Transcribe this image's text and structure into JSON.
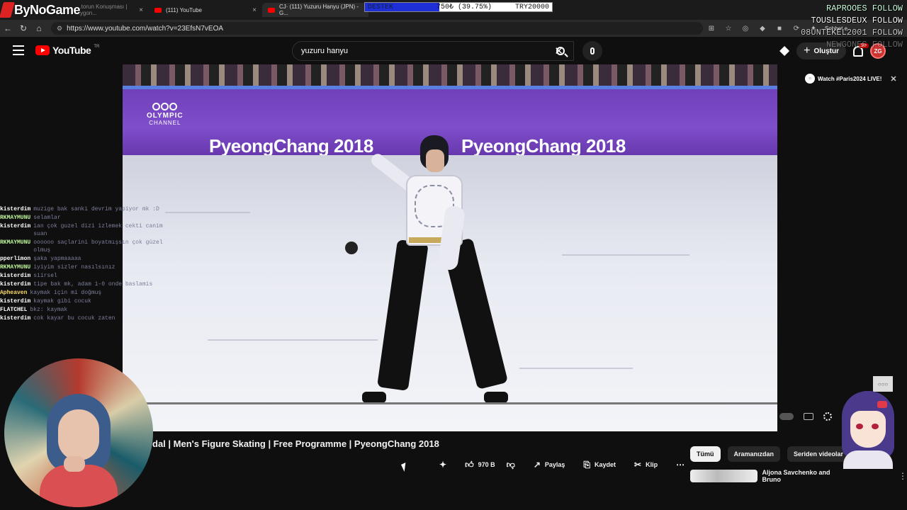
{
  "browser": {
    "tabs": [
      {
        "label": "...torun Konuşması | Zygon..."
      },
      {
        "label": "(111) YouTube"
      },
      {
        "label": "CJ· (111) Yuzuru Hanyu (JPN) - G..."
      }
    ],
    "url": "https://www.youtube.com/watch?v=23EfsN7vEOA",
    "sohbet": "Sohbet e"
  },
  "stream_overlay": {
    "logo": "ByNoGame",
    "donation": {
      "label": "DESTEK",
      "amount": "750₺ (39.75%)",
      "goal": "TRY20000",
      "progress": 0.3975
    },
    "follows": [
      "RAPROOES FOLLOW",
      "TOUSLESDEUX FOLLOW",
      "08UNTEKEL2001 FOLLOW",
      "NEWGONES FOLLOW"
    ],
    "chat": [
      {
        "user": "kisterdim",
        "msg": "muzige bak sanki devrim yapiyor mk :D",
        "c": ""
      },
      {
        "user": "RKMAYMUNU",
        "msg": "selamlar",
        "c": "g"
      },
      {
        "user": "kisterdim",
        "msg": "ian çok guzel dizi izlemek cekti canim suan",
        "c": ""
      },
      {
        "user": "RKMAYMUNU",
        "msg": "oooooo saçlarini boyatmışsın çok güzel olmuş",
        "c": "g"
      },
      {
        "user": "pperlimon",
        "msg": "şaka yapmaaaaa",
        "c": ""
      },
      {
        "user": "RKMAYMUNU",
        "msg": "iyiyim sizler nasılsınız",
        "c": "g"
      },
      {
        "user": "kisterdim",
        "msg": "siirsel",
        "c": ""
      },
      {
        "user": "kisterdim",
        "msg": "tipe bak mk, adam 1-0 onde baslamis",
        "c": ""
      },
      {
        "user": "Apheaven",
        "msg": "kaymak için mi doğmuş",
        "c": "y"
      },
      {
        "user": "kisterdim",
        "msg": "kaymak gibi cocuk",
        "c": ""
      },
      {
        "user": "FLATCHEL",
        "msg": "bkz: kaymak",
        "c": ""
      },
      {
        "user": "kisterdim",
        "msg": "cok kayar bu cocuk zaten",
        "c": ""
      }
    ]
  },
  "youtube": {
    "logo": "YouTube",
    "country": "TR",
    "search_query": "yuzuru hanyu",
    "create_label": "Oluştur",
    "notif_count": "9+",
    "video": {
      "title": "dal | Men's Figure Skating | Free Programme | PyeongChang 2018",
      "board_text": "PyeongChang 2018",
      "channel_wm_1": "OLYMPIC",
      "channel_wm_2": "CHANNEL",
      "progress": 1.0
    },
    "actions": {
      "likes": "970 B",
      "share": "Paylaş",
      "save": "Kaydet",
      "clip": "Klip"
    },
    "promo": "Watch #Paris2024 LIVE!",
    "chips": [
      "Tümü",
      "Aramanızdan",
      "Seriden videolar"
    ],
    "rec_title": "Aljona Savchenko and Bruno"
  }
}
